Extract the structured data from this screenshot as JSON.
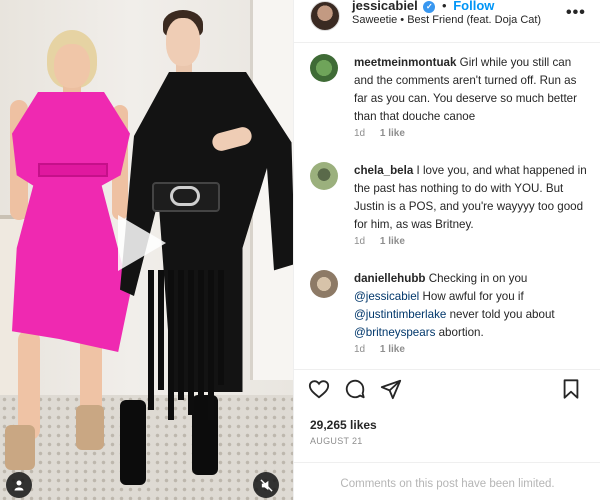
{
  "header": {
    "username": "jessicabiel",
    "separator": "•",
    "follow_label": "Follow",
    "music": "Saweetie • Best Friend (feat. Doja Cat)",
    "more_icon": "more-horizontal-icon"
  },
  "media": {
    "play_icon": "play-icon",
    "user_icon": "user-tag-icon",
    "mute_icon": "muted-speaker-icon"
  },
  "comments": [
    {
      "username": "meetmeinmontuak",
      "text": "Girl while you still can and the comments aren't turned off. Run as far as you can. You deserve so much better than that douche canoe",
      "time": "1d",
      "likes": "1 like"
    },
    {
      "username": "chela_bela",
      "text": "I love you, and what happened in the past has nothing to do with YOU. But Justin is a POS, and you're wayyyy too good for him, as was Britney.",
      "time": "1d",
      "likes": "1 like"
    },
    {
      "username": "daniellehubb",
      "text_1": "Checking in on you",
      "mention_1": "@jessicabiel",
      "text_2": "How awful for you if",
      "mention_2": "@justintimberlake",
      "text_3": "never told you about",
      "mention_3": "@britneyspears",
      "text_4": "abortion.",
      "time": "1d",
      "likes": "1 like"
    }
  ],
  "actions": {
    "like_icon": "heart-icon",
    "comment_icon": "comment-icon",
    "share_icon": "share-icon",
    "save_icon": "bookmark-icon"
  },
  "likes_count": "29,265 likes",
  "date": "AUGUST 21",
  "comments_limited": "Comments on this post have been limited.",
  "colors": {
    "link_blue": "#0095f6",
    "mention_blue": "#00376b",
    "muted_gray": "#8e8e8e"
  }
}
